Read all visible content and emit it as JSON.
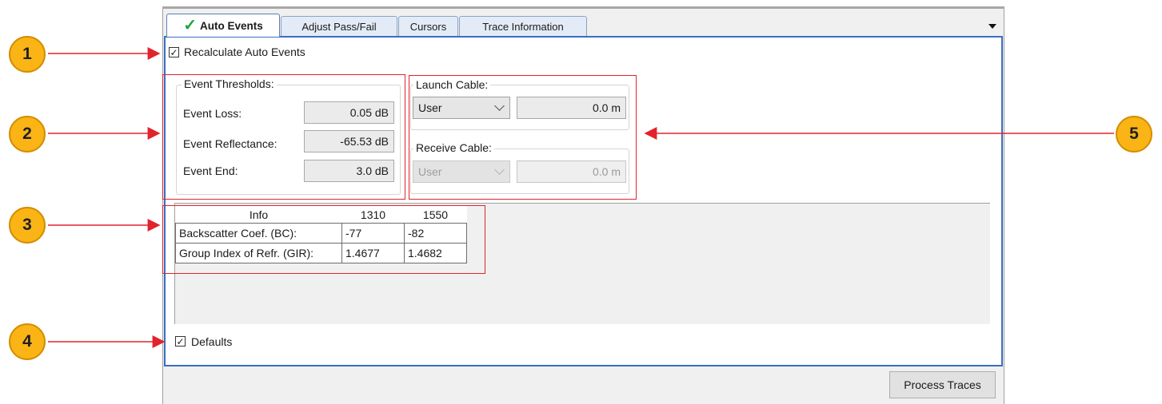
{
  "tabs": [
    {
      "label": "Auto Events",
      "active": true,
      "icon": "checkmark-icon"
    },
    {
      "label": "Adjust Pass/Fail",
      "active": false
    },
    {
      "label": "Cursors",
      "active": false
    },
    {
      "label": "Trace Information",
      "active": false
    }
  ],
  "recalculate": {
    "label": "Recalculate Auto Events",
    "checked": true
  },
  "thresholds": {
    "legend": "Event Thresholds:",
    "loss_label": "Event Loss:",
    "loss_value": "0.05 dB",
    "reflectance_label": "Event Reflectance:",
    "reflectance_value": "-65.53 dB",
    "end_label": "Event End:",
    "end_value": "3.0 dB"
  },
  "launch_cable": {
    "legend": "Launch Cable:",
    "select": "User",
    "value": "0.0 m"
  },
  "receive_cable": {
    "legend": "Receive Cable:",
    "select": "User",
    "value": "0.0 m",
    "disabled": true
  },
  "info_table": {
    "headers": [
      "Info",
      "1310",
      "1550"
    ],
    "rows": [
      [
        "Backscatter Coef. (BC):",
        "-77",
        "-82"
      ],
      [
        "Group Index of Refr. (GIR):",
        "1.4677",
        "1.4682"
      ]
    ]
  },
  "defaults": {
    "label": "Defaults",
    "checked": true
  },
  "process_button": "Process Traces",
  "callouts": [
    "1",
    "2",
    "3",
    "4",
    "5"
  ],
  "colors": {
    "highlight": "#e2232b",
    "callout": "#fbb415",
    "panel_border": "#3b6fc1",
    "check": "#22a33a"
  }
}
